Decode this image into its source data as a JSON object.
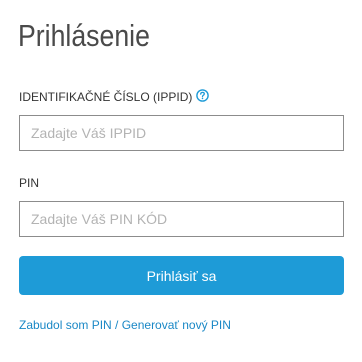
{
  "login": {
    "title": "Prihlásenie",
    "ippid_label": "IDENTIFIKAČNÉ ČÍSLO (IPPID)",
    "ippid_placeholder": "Zadajte Váš IPPID",
    "ippid_value": "",
    "pin_label": "PIN",
    "pin_placeholder": "Zadajte Váš PIN KÓD",
    "pin_value": "",
    "submit_label": "Prihlásiť sa",
    "forgot_link": "Zabudol som PIN / Generovať nový PIN",
    "help_icon": "question-circle-icon"
  },
  "colors": {
    "accent": "#1e9bd7",
    "link": "#1a88c6",
    "title": "#4a4a4a",
    "input_border": "#8c8c8c",
    "placeholder": "#b3b3b3"
  }
}
